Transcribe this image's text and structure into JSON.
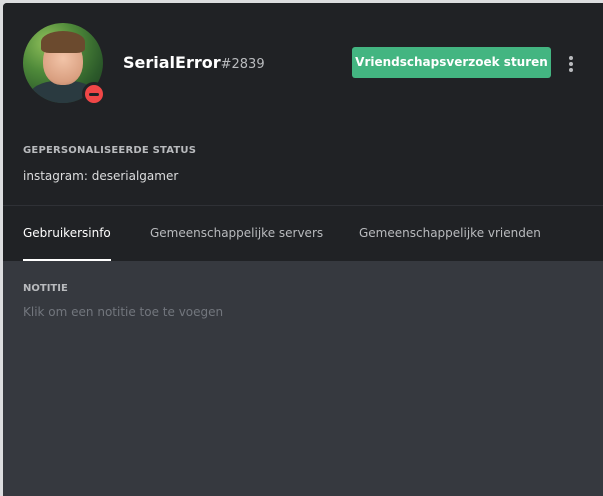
{
  "profile": {
    "username": "SerialError",
    "discriminator": "#2839",
    "status": "do-not-disturb",
    "avatar_icon": "user-avatar-photo"
  },
  "actions": {
    "send_friend_request_label": "Vriendschapsverzoek sturen",
    "overflow_icon": "vertical-ellipsis-icon"
  },
  "custom_status": {
    "label": "GEPERSONALISEERDE STATUS",
    "text": "instagram: deserialgamer"
  },
  "tabs": [
    {
      "label": "Gebruikersinfo",
      "active": true
    },
    {
      "label": "Gemeenschappelijke servers",
      "active": false
    },
    {
      "label": "Gemeenschappelijke vrienden",
      "active": false
    }
  ],
  "note": {
    "label": "NOTITIE",
    "placeholder": "Klik om een notitie toe te voegen"
  },
  "colors": {
    "header_bg": "#202225",
    "body_bg": "#36393f",
    "accent_green": "#43b581",
    "dnd_red": "#f04747"
  }
}
